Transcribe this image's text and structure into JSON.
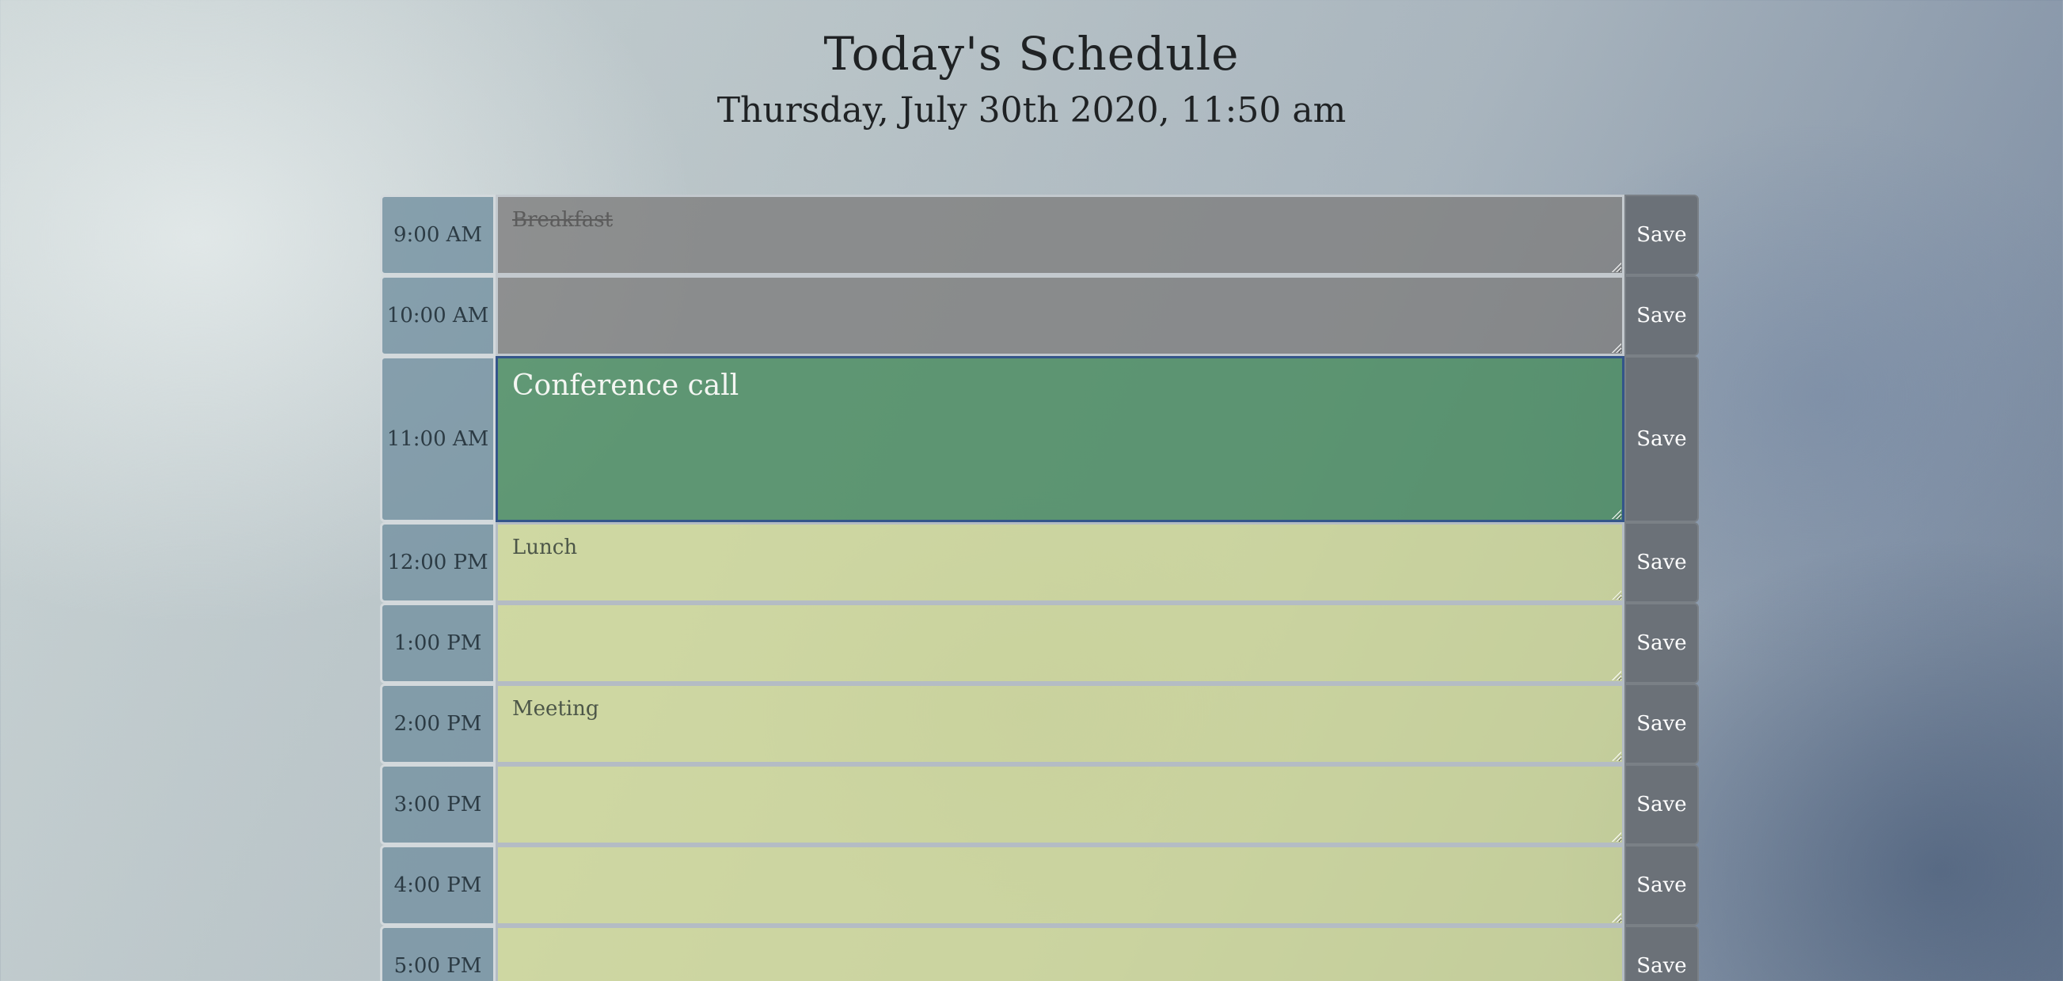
{
  "header": {
    "title": "Today's Schedule",
    "current_datetime": "Thursday, July 30th 2020, 11:50 am"
  },
  "schedule": {
    "save_label": "Save",
    "rows": [
      {
        "hour": "9:00 AM",
        "text": "Breakfast",
        "status": "past"
      },
      {
        "hour": "10:00 AM",
        "text": "",
        "status": "past"
      },
      {
        "hour": "11:00 AM",
        "text": "Conference call",
        "status": "present"
      },
      {
        "hour": "12:00 PM",
        "text": "Lunch",
        "status": "future"
      },
      {
        "hour": "1:00 PM",
        "text": "",
        "status": "future"
      },
      {
        "hour": "2:00 PM",
        "text": "Meeting",
        "status": "future"
      },
      {
        "hour": "3:00 PM",
        "text": "",
        "status": "future"
      },
      {
        "hour": "4:00 PM",
        "text": "",
        "status": "future"
      },
      {
        "hour": "5:00 PM",
        "text": "",
        "status": "future"
      }
    ]
  },
  "colors": {
    "past": "#808080",
    "present": "#4a8c60",
    "future": "#d6de96",
    "save_button": "#6b7178",
    "hour_cell": "#7894a3"
  }
}
